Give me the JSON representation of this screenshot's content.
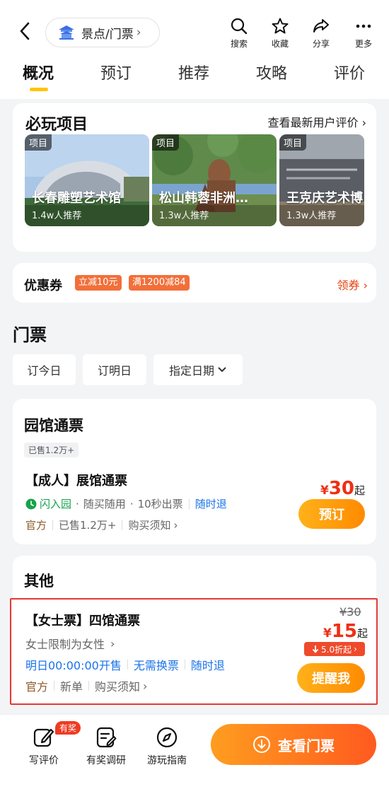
{
  "header": {
    "crumb": "景点/门票",
    "tools": [
      {
        "label": "搜索",
        "icon": "search-icon"
      },
      {
        "label": "收藏",
        "icon": "star-icon"
      },
      {
        "label": "分享",
        "icon": "share-icon"
      },
      {
        "label": "更多",
        "icon": "more-icon"
      }
    ]
  },
  "tabs": [
    "概况",
    "预订",
    "推荐",
    "攻略",
    "评价"
  ],
  "must_play": {
    "title": "必玩项目",
    "link": "查看最新用户评价",
    "items": [
      {
        "tag": "项目",
        "name": "长春雕塑艺术馆",
        "recommend": "1.4w人推荐"
      },
      {
        "tag": "项目",
        "name": "松山韩蓉非洲…",
        "recommend": "1.3w人推荐"
      },
      {
        "tag": "项目",
        "name": "王克庆艺术博",
        "recommend": "1.3w人推荐"
      }
    ]
  },
  "coupon": {
    "label": "优惠券",
    "tags": [
      "立减10元",
      "满1200减84"
    ],
    "action": "领券"
  },
  "tickets": {
    "title": "门票",
    "date_buttons": [
      "订今日",
      "订明日",
      "指定日期"
    ]
  },
  "park_pass": {
    "title": "园馆通票",
    "sold_badge": "已售1.2万+",
    "item": {
      "title": "【成人】展馆通票",
      "flash": "闪入园",
      "features": [
        "随买随用",
        "10秒出票"
      ],
      "refund": "随时退",
      "official": "官方",
      "sold": "已售1.2万+",
      "notice": "购买须知",
      "currency": "¥",
      "price": "30",
      "price_suffix": "起",
      "button": "预订"
    }
  },
  "other": {
    "title": "其他",
    "item": {
      "title": "【女士票】四馆通票",
      "restriction": "女士限制为女性",
      "open_time": "明日00:00:00开售",
      "no_exchange": "无需换票",
      "refund": "随时退",
      "official": "官方",
      "new_tag": "新单",
      "notice": "购买须知",
      "orig_price": "¥30",
      "currency": "¥",
      "price": "15",
      "price_suffix": "起",
      "discount": "5.0折起",
      "button": "提醒我"
    }
  },
  "bottom": {
    "items": [
      "写评价",
      "有奖调研",
      "游玩指南"
    ],
    "prize_badge": "有奖",
    "cta": "查看门票"
  },
  "colors": {
    "accent": "#ff8a00",
    "price": "#ef2f12",
    "link": "#1a73e8",
    "tab_underline": "#ffc400"
  }
}
